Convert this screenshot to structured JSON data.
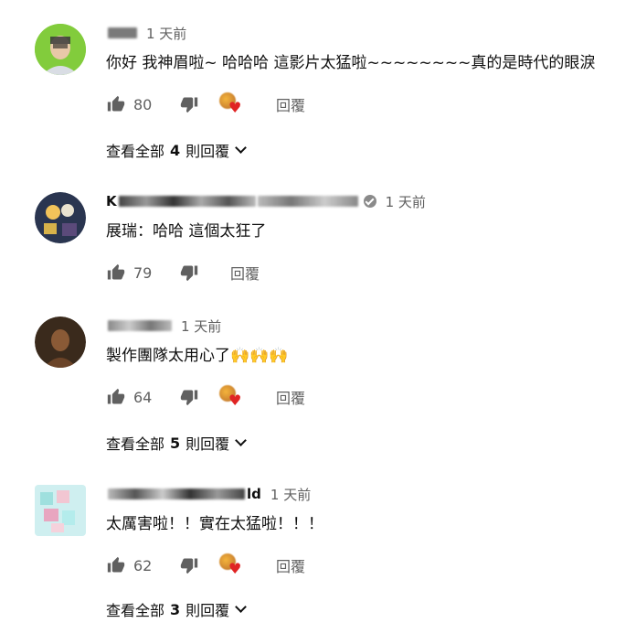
{
  "comments": [
    {
      "author": "",
      "time": "1 天前",
      "text": "你好 我神眉啦~ 哈哈哈 這影片太猛啦~~~~~~~~真的是時代的眼淚",
      "likes": "80",
      "reply_label": "回覆",
      "has_heart": true,
      "verified": false,
      "view_replies": {
        "prefix": "查看全部",
        "count": "4",
        "suffix": "則回覆"
      }
    },
    {
      "author": "K",
      "time": "1 天前",
      "text": "展瑞：哈哈 這個太狂了",
      "likes": "79",
      "reply_label": "回覆",
      "has_heart": false,
      "verified": true,
      "view_replies": null
    },
    {
      "author": "",
      "time": "1 天前",
      "text": "製作團隊太用心了",
      "text_emoji": "🙌🙌🙌",
      "likes": "64",
      "reply_label": "回覆",
      "has_heart": true,
      "verified": false,
      "view_replies": {
        "prefix": "查看全部",
        "count": "5",
        "suffix": "則回覆"
      }
    },
    {
      "author": "ld",
      "time": "1 天前",
      "text": "太厲害啦！！實在太猛啦！！！",
      "likes": "62",
      "reply_label": "回覆",
      "has_heart": true,
      "verified": false,
      "view_replies": {
        "prefix": "查看全部",
        "count": "3",
        "suffix": "則回覆"
      }
    }
  ],
  "colors": {
    "text_primary": "#0f0f0f",
    "text_secondary": "#606060",
    "heart": "#e02424"
  }
}
